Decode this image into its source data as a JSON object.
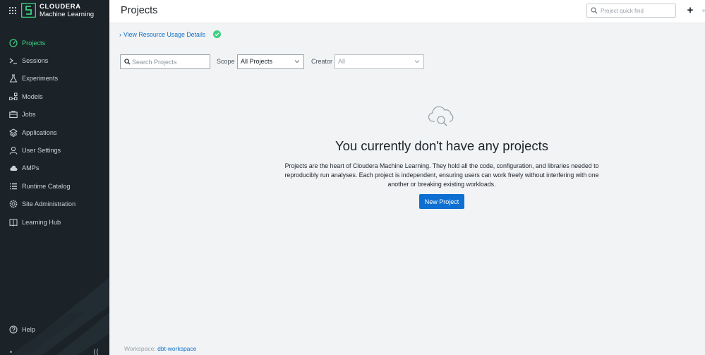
{
  "brand": {
    "line1": "CLOUDERA",
    "line2": "Machine Learning"
  },
  "nav": [
    {
      "label": "Projects",
      "icon": "projects-gauge-icon",
      "active": true
    },
    {
      "label": "Sessions",
      "icon": "terminal-prompt-icon"
    },
    {
      "label": "Experiments",
      "icon": "flask-icon"
    },
    {
      "label": "Models",
      "icon": "models-nodes-icon"
    },
    {
      "label": "Jobs",
      "icon": "briefcase-icon"
    },
    {
      "label": "Applications",
      "icon": "layers-icon"
    },
    {
      "label": "User Settings",
      "icon": "user-icon"
    },
    {
      "label": "AMPs",
      "icon": "cloud-icon"
    },
    {
      "label": "Runtime Catalog",
      "icon": "list-icon"
    },
    {
      "label": "Site Administration",
      "icon": "gear-icon"
    },
    {
      "label": "Learning Hub",
      "icon": "book-icon"
    }
  ],
  "help_label": "Help",
  "collapse_glyph": "⟨⟨",
  "header": {
    "title": "Projects",
    "quick_find_placeholder": "Project quick find",
    "plus_label": "+"
  },
  "resource_link": "View Resource Usage Details",
  "filters": {
    "search_placeholder": "Search Projects",
    "scope_label": "Scope",
    "scope_value": "All Projects",
    "creator_label": "Creator",
    "creator_value": "All"
  },
  "empty": {
    "title": "You currently don't have any projects",
    "description": "Projects are the heart of Cloudera Machine Learning. They hold all the code, configuration, and libraries needed to reproducibly run analyses. Each project is independent, ensuring users can work freely without interfering with one another or breaking existing workloads.",
    "button": "New Project"
  },
  "workspace": {
    "label": "Workspace:",
    "name": "dbt-workspace"
  },
  "colors": {
    "sidebar": "#1b2329",
    "active": "#3dd17f",
    "link": "#1172c7",
    "primary": "#0d6fd1"
  }
}
